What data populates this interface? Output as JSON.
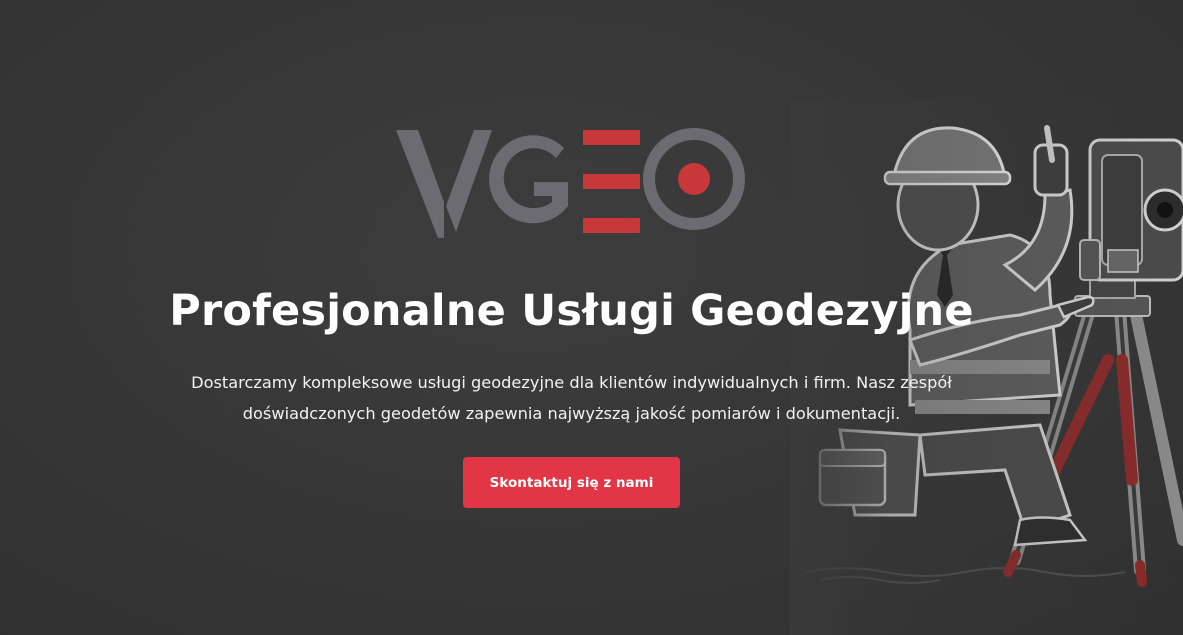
{
  "brand": {
    "logo_text": "VGEO",
    "accent_color": "#e03645",
    "logo_gray": "#6c6b72"
  },
  "hero": {
    "headline": "Profesjonalne Usługi Geodezyjne",
    "lead": "Dostarczamy kompleksowe usługi geodezyjne dla klientów indywidualnych i firm. Nasz zespół doświadczonych geodetów zapewnia najwyższą jakość pomiarów i dokumentacji.",
    "cta_label": "Skontaktuj się z nami",
    "illustration": "surveyor-with-total-station"
  }
}
